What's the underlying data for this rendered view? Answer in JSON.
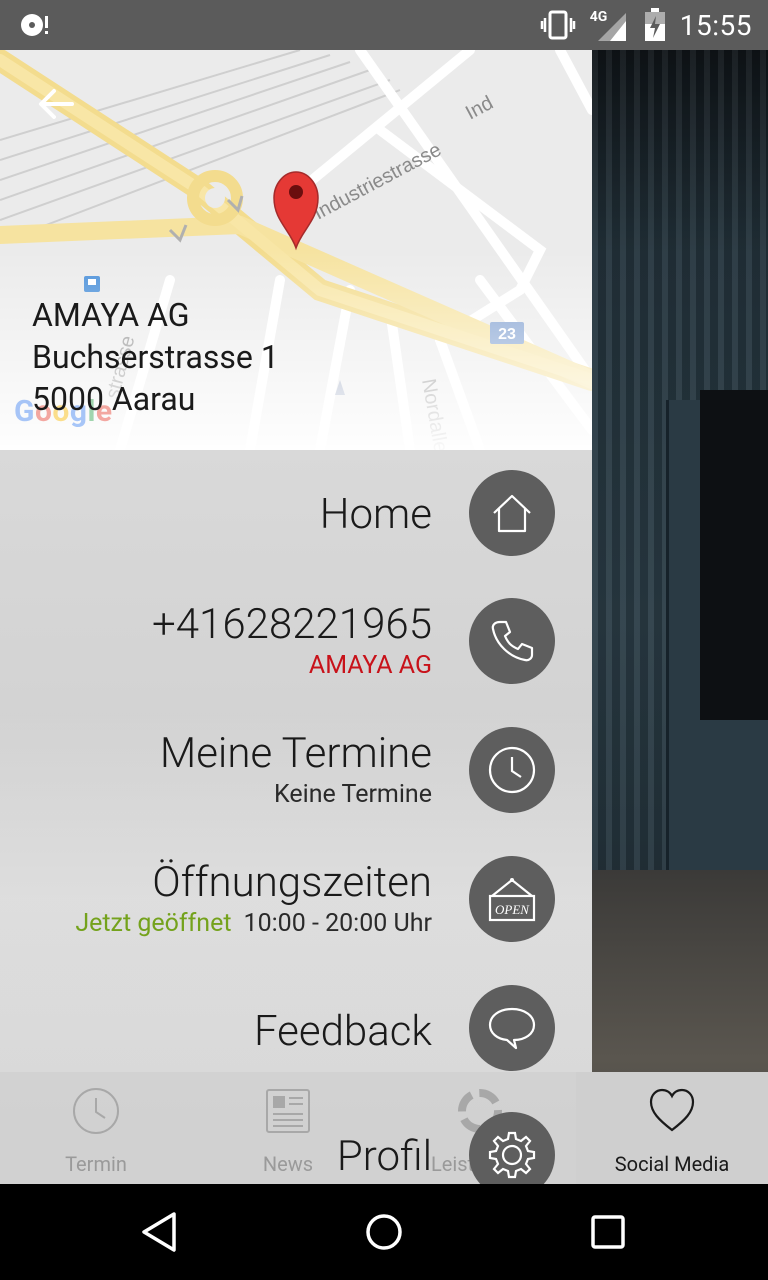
{
  "status_bar": {
    "network": "4G",
    "time": "15:55"
  },
  "map": {
    "street_label_1": "Industriestrasse",
    "street_label_2": "Ind",
    "street_label_3": "Nordallee",
    "street_label_4": "strasse",
    "road_badge": "23",
    "logo": "Google",
    "address": {
      "name": "AMAYA AG",
      "street": "Buchserstrasse 1",
      "city": "5000 Aarau"
    }
  },
  "menu": {
    "home": {
      "title": "Home"
    },
    "phone": {
      "title": "+41628221965",
      "subtitle": "AMAYA AG"
    },
    "termine": {
      "title": "Meine Termine",
      "subtitle": "Keine Termine"
    },
    "hours": {
      "title": "Öffnungszeiten",
      "status": "Jetzt geöffnet",
      "time": "10:00 - 20:00 Uhr",
      "sign_text": "OPEN"
    },
    "feedback": {
      "title": "Feedback"
    },
    "profil": {
      "title": "Profil"
    }
  },
  "tabs": [
    {
      "label": "Termin",
      "icon": "clock-icon"
    },
    {
      "label": "News",
      "icon": "newspaper-icon"
    },
    {
      "label": "Leistungen",
      "icon": "services-icon"
    },
    {
      "label": "Social Media",
      "icon": "heart-icon"
    }
  ],
  "colors": {
    "accent_red": "#c8121a",
    "accent_green": "#74a21c",
    "circle_gray": "#5e5e5e"
  }
}
